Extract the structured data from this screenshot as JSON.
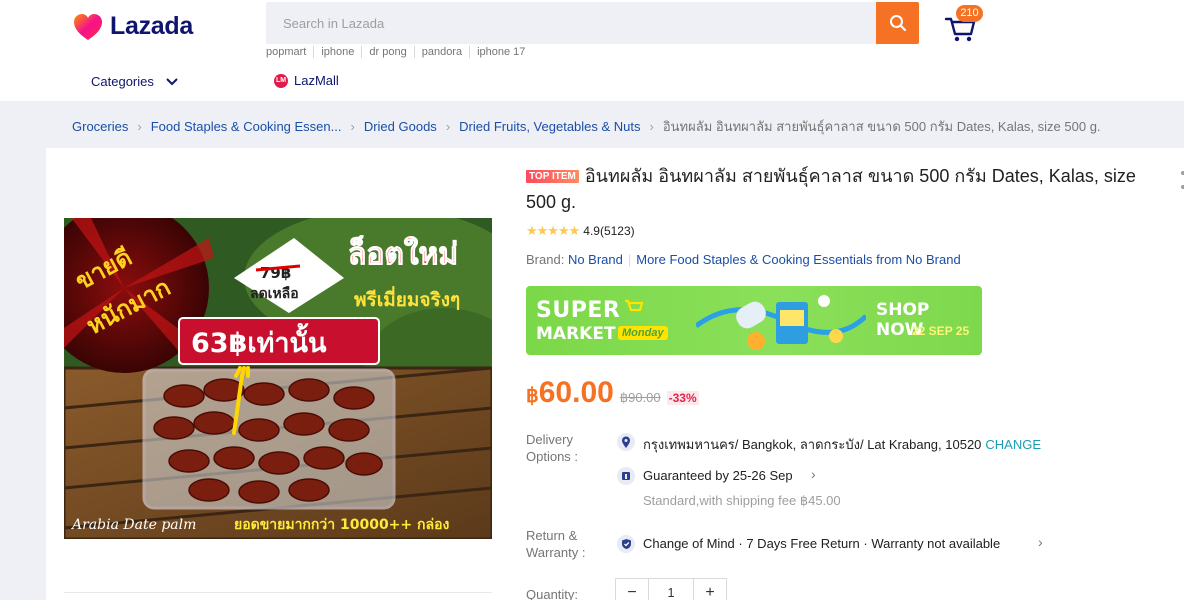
{
  "header": {
    "logo_text": "Lazada",
    "search_placeholder": "Search in Lazada",
    "cart_count": "210",
    "keywords": [
      "popmart",
      "iphone",
      "dr pong",
      "pandora",
      "iphone 17"
    ],
    "categories_label": "Categories",
    "lazmall_label": "LazMall",
    "lazmall_badge": "LM"
  },
  "breadcrumb": {
    "items": [
      "Groceries",
      "Food Staples & Cooking Essen...",
      "Dried Goods",
      "Dried Fruits, Vegetables & Nuts"
    ],
    "current": "อินทผลัม อินทผาลัม สายพันธุ์คาลาส ขนาด 500 กรัม Dates, Kalas, size 500 g."
  },
  "product": {
    "badge": "TOP ITEM",
    "title": "อินทผลัม อินทผาลัม สายพันธุ์คาลาส ขนาด 500 กรัม Dates, Kalas, size 500 g.",
    "stars": "★★★★★",
    "rating": "4.9(5123)",
    "brand_label": "Brand:",
    "brand_name": "No Brand",
    "brand_more": "More Food Staples & Cooking Essentials from No Brand",
    "image": {
      "badge_left_1": "ขายดี",
      "badge_left_2": "หนักมาก",
      "old_price_tag": "79฿",
      "remaining": "ลดเหลือ",
      "headline": "ล็อตใหม่",
      "subline": "พรีเมี่ยมจริงๆ",
      "price_banner": "63฿เท่านั้น",
      "footer_left": "Arabia Date palm",
      "footer_right": "ยอดขายมากกว่า 10000++ กล่อง"
    }
  },
  "banner": {
    "line1": "SUPER",
    "line2": "MARKET",
    "tag": "Monday",
    "cta": "SHOP NOW",
    "date": "22 SEP 25"
  },
  "price": {
    "currency": "฿",
    "current": "60.00",
    "original": "฿90.00",
    "discount": "-33%"
  },
  "delivery": {
    "label": "Delivery Options :",
    "address": "กรุงเทพมหานคร/ Bangkok, ลาดกระบัง/ Lat Krabang, 10520",
    "change": "CHANGE",
    "guarantee": "Guaranteed by 25-26 Sep",
    "shipping": "Standard,with shipping fee ฿45.00"
  },
  "warranty": {
    "label": "Return & Warranty :",
    "text": "Change of Mind · 7 Days Free Return · Warranty not available"
  },
  "quantity": {
    "label": "Quantity:",
    "minus": "−",
    "value": "1",
    "plus": "+"
  },
  "colors": {
    "accent": "#f57224",
    "link": "#1a4ea8",
    "brand_navy": "#0f146d",
    "discount": "#e4264c"
  }
}
